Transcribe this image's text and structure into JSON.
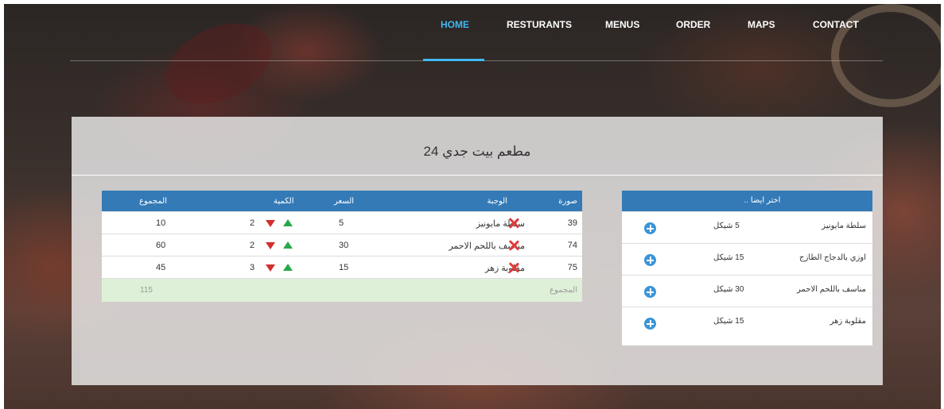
{
  "nav": {
    "items": [
      {
        "label": "HOME"
      },
      {
        "label": "RESTURANTS"
      },
      {
        "label": "MENUS"
      },
      {
        "label": "ORDER"
      },
      {
        "label": "MAPS"
      },
      {
        "label": "CONTACT"
      }
    ],
    "active_color": "#3fb8f0"
  },
  "panel": {
    "title": "مطعم بيت جدي 24"
  },
  "side_menu": {
    "header": "اختر ايضا ..",
    "items": [
      {
        "name": "سلطة مايونيز",
        "price": "5 شيكل"
      },
      {
        "name": "اوزي بالدجاج الطازج",
        "price": "15 شيكل"
      },
      {
        "name": "مناسف باللحم الاحمر",
        "price": "30 شيكل"
      },
      {
        "name": "مقلوبة زهر",
        "price": "15 شيكل"
      }
    ],
    "add_icon": "plus-circle-icon"
  },
  "order_table": {
    "headers": {
      "image": "صورة",
      "meal": "الوجبة",
      "price": "السعر",
      "quantity": "الكمية",
      "total": "المجموع"
    },
    "rows": [
      {
        "image": "39",
        "meal": "سلطة مايونيز",
        "price": "5",
        "quantity": "2",
        "total": "10"
      },
      {
        "image": "74",
        "meal": "مناسف باللحم الاحمر",
        "price": "30",
        "quantity": "2",
        "total": "60"
      },
      {
        "image": "75",
        "meal": "مقلوبة زهر",
        "price": "15",
        "quantity": "3",
        "total": "45"
      }
    ],
    "footer": {
      "label": "المجموع",
      "value": "115"
    },
    "header_color": "#337ab7",
    "footer_color": "#dff0d8"
  }
}
